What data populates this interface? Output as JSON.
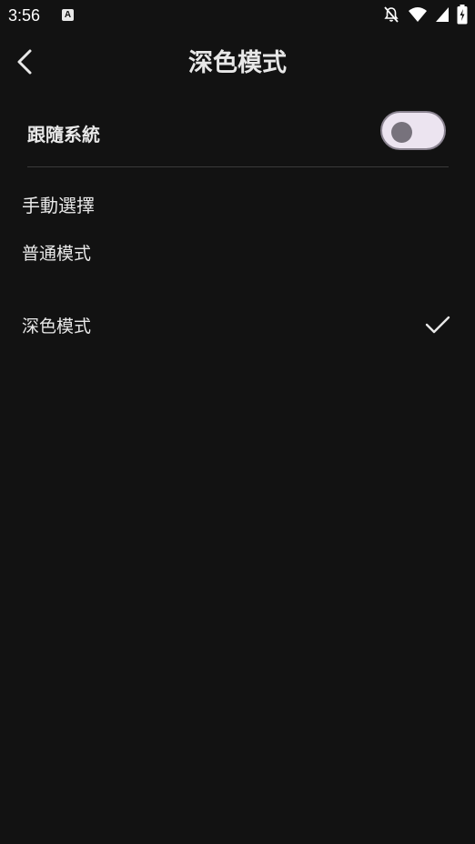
{
  "status_bar": {
    "time": "3:56",
    "app_icon_letter": "A",
    "icons": [
      "notifications-off-icon",
      "wifi-icon",
      "cell-signal-icon",
      "battery-charging-icon"
    ]
  },
  "header": {
    "title": "深色模式",
    "back_icon": "chevron-left-icon"
  },
  "follow_system": {
    "label": "跟隨系統",
    "enabled": false
  },
  "manual": {
    "section_label": "手動選擇",
    "options": [
      {
        "label": "普通模式",
        "selected": false
      },
      {
        "label": "深色模式",
        "selected": true
      }
    ]
  },
  "colors": {
    "background": "#121212",
    "text": "#e8e8e8",
    "toggle_track": "#ece4f0",
    "toggle_thumb": "#77727c"
  }
}
